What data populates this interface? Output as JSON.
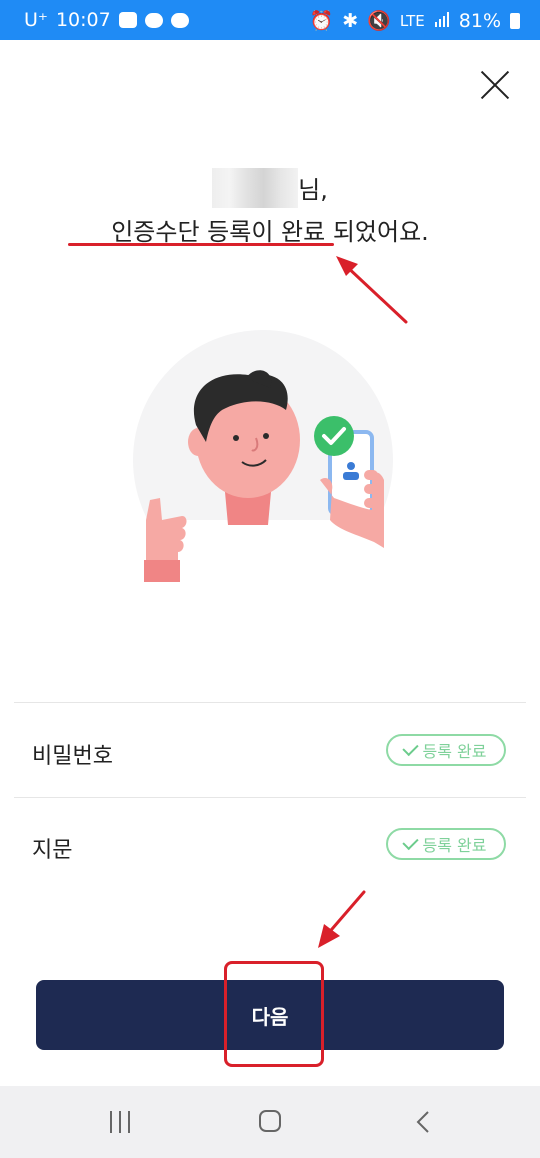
{
  "status_bar": {
    "carrier": "U⁺",
    "time": "10:07",
    "network": "LTE",
    "battery": "81%",
    "left_icons": [
      "gallery-icon",
      "talk-icon",
      "message-icon"
    ],
    "right_icons": [
      "alarm-icon",
      "bluetooth-icon",
      "mute-icon",
      "lte-icon",
      "signal-icon",
      "battery-icon"
    ]
  },
  "header": {
    "close_icon": "close-icon"
  },
  "message": {
    "name_suffix": "님,",
    "line2": "인증수단 등록이 완료 되었어요."
  },
  "methods": [
    {
      "label": "비밀번호",
      "status": "등록 완료"
    },
    {
      "label": "지문",
      "status": "등록 완료"
    }
  ],
  "next_button": {
    "label": "다음"
  },
  "nav_bar": {
    "icons": [
      "recent-apps-icon",
      "home-icon",
      "back-icon"
    ]
  },
  "colors": {
    "status_bar": "#1f8bf5",
    "button": "#1e2a52",
    "badge": "#8edaa5",
    "annotation": "#d9202a"
  }
}
